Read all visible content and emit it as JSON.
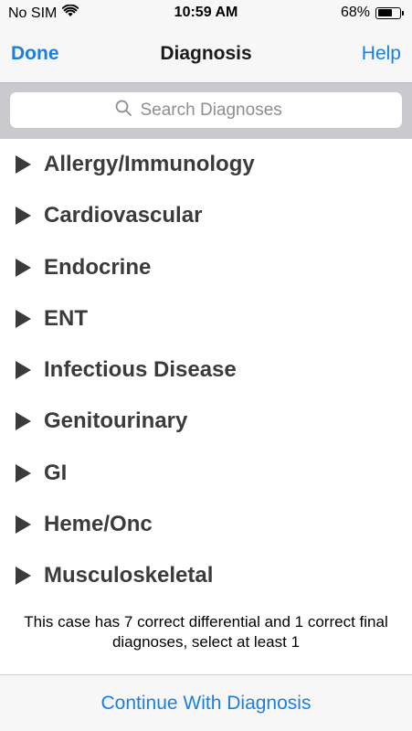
{
  "status_bar": {
    "carrier": "No SIM",
    "time": "10:59 AM",
    "battery_percent_text": "68%",
    "battery_level": 0.68,
    "wifi_icon": "wifi-icon",
    "battery_icon": "battery-icon"
  },
  "nav": {
    "left_label": "Done",
    "title": "Diagnosis",
    "right_label": "Help"
  },
  "search": {
    "placeholder": "Search Diagnoses",
    "value": "",
    "icon": "search-icon"
  },
  "categories": [
    {
      "label": "Allergy/Immunology"
    },
    {
      "label": "Cardiovascular"
    },
    {
      "label": "Endocrine"
    },
    {
      "label": "ENT"
    },
    {
      "label": "Infectious Disease"
    },
    {
      "label": "Genitourinary"
    },
    {
      "label": "GI"
    },
    {
      "label": "Heme/Onc"
    },
    {
      "label": "Musculoskeletal"
    }
  ],
  "info_text": "This case has 7 correct differential and 1 correct final diagnoses, select at least 1",
  "footer": {
    "button_label": "Continue With Diagnosis"
  },
  "colors": {
    "accent": "#1a7fe0",
    "item_text": "#3b3b3b",
    "search_bar_bg": "#c9c9ce"
  }
}
